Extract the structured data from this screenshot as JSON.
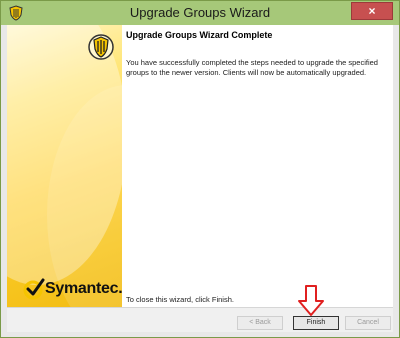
{
  "window": {
    "title": "Upgrade Groups Wizard",
    "close_label": "×"
  },
  "brand": {
    "name": "Symantec."
  },
  "content": {
    "heading": "Upgrade Groups Wizard Complete",
    "body": "You have successfully completed the steps needed to upgrade the specified groups to the newer version. Clients will now be automatically upgraded.",
    "footer": "To close this wizard, click Finish."
  },
  "buttons": {
    "back": "< Back",
    "finish": "Finish",
    "cancel": "Cancel"
  },
  "colors": {
    "titlebar": "#a6c879",
    "close": "#c75050",
    "arrow": "#e02020"
  }
}
